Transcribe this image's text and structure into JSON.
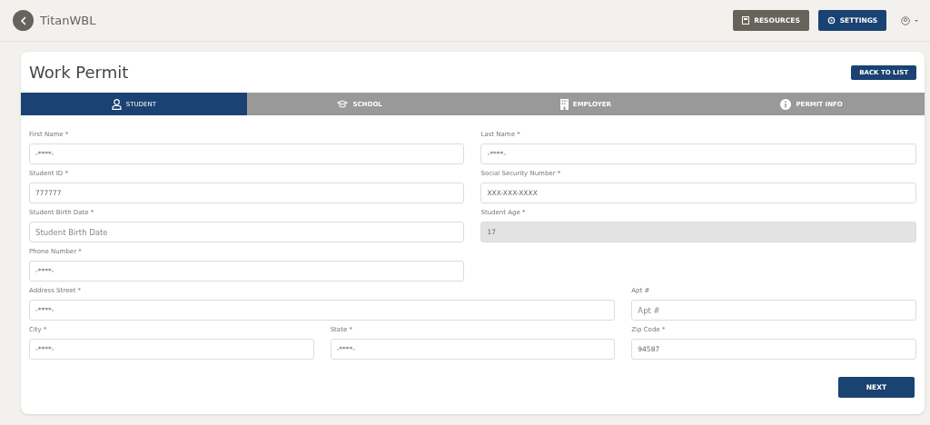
{
  "header": {
    "app_name": "TitanWBL",
    "buttons": [
      {
        "label": "RESOURCES",
        "kind": "secondary"
      },
      {
        "label": "SETTINGS",
        "kind": "primary"
      }
    ]
  },
  "card": {
    "title": "Work Permit",
    "back_button": "BACK TO LIST"
  },
  "tabs": [
    {
      "label": "STUDENT",
      "selected": true
    },
    {
      "label": "SCHOOL",
      "selected": false
    },
    {
      "label": "EMPLOYER",
      "selected": false
    },
    {
      "label": "PERMIT INFO",
      "selected": false
    }
  ],
  "fields": [
    {
      "label": "First Name *",
      "value": "-****-",
      "kind": "half",
      "disabled": false
    },
    {
      "label": "Last Name *",
      "value": "-****-",
      "kind": "half",
      "disabled": false
    },
    {
      "label": "Student ID *",
      "value": "777777",
      "kind": "half",
      "disabled": false
    },
    {
      "label": "Social Security Number *",
      "value": "XXX-XXX-XXXX",
      "kind": "half",
      "disabled": false
    },
    {
      "label": "Student Birth Date *",
      "placeholder": "Student Birth Date",
      "kind": "half",
      "disabled": false
    },
    {
      "label": "Student Age *",
      "value": "17",
      "kind": "half",
      "disabled": true
    },
    {
      "label": "Phone Number *",
      "value": "-****-",
      "kind": "half",
      "disabled": false
    },
    {
      "label": "Address Street *",
      "value": "-****-",
      "kind": "wide",
      "disabled": false
    },
    {
      "label": "Apt #",
      "placeholder": "Apt #",
      "kind": "third",
      "disabled": false
    },
    {
      "label": "City *",
      "value": "-****-",
      "kind": "third",
      "disabled": false
    },
    {
      "label": "State *",
      "value": "-****-",
      "kind": "third",
      "disabled": false
    },
    {
      "label": "Zip Code *",
      "value": "94587",
      "kind": "third",
      "disabled": false
    }
  ],
  "next_button": "NEXT"
}
